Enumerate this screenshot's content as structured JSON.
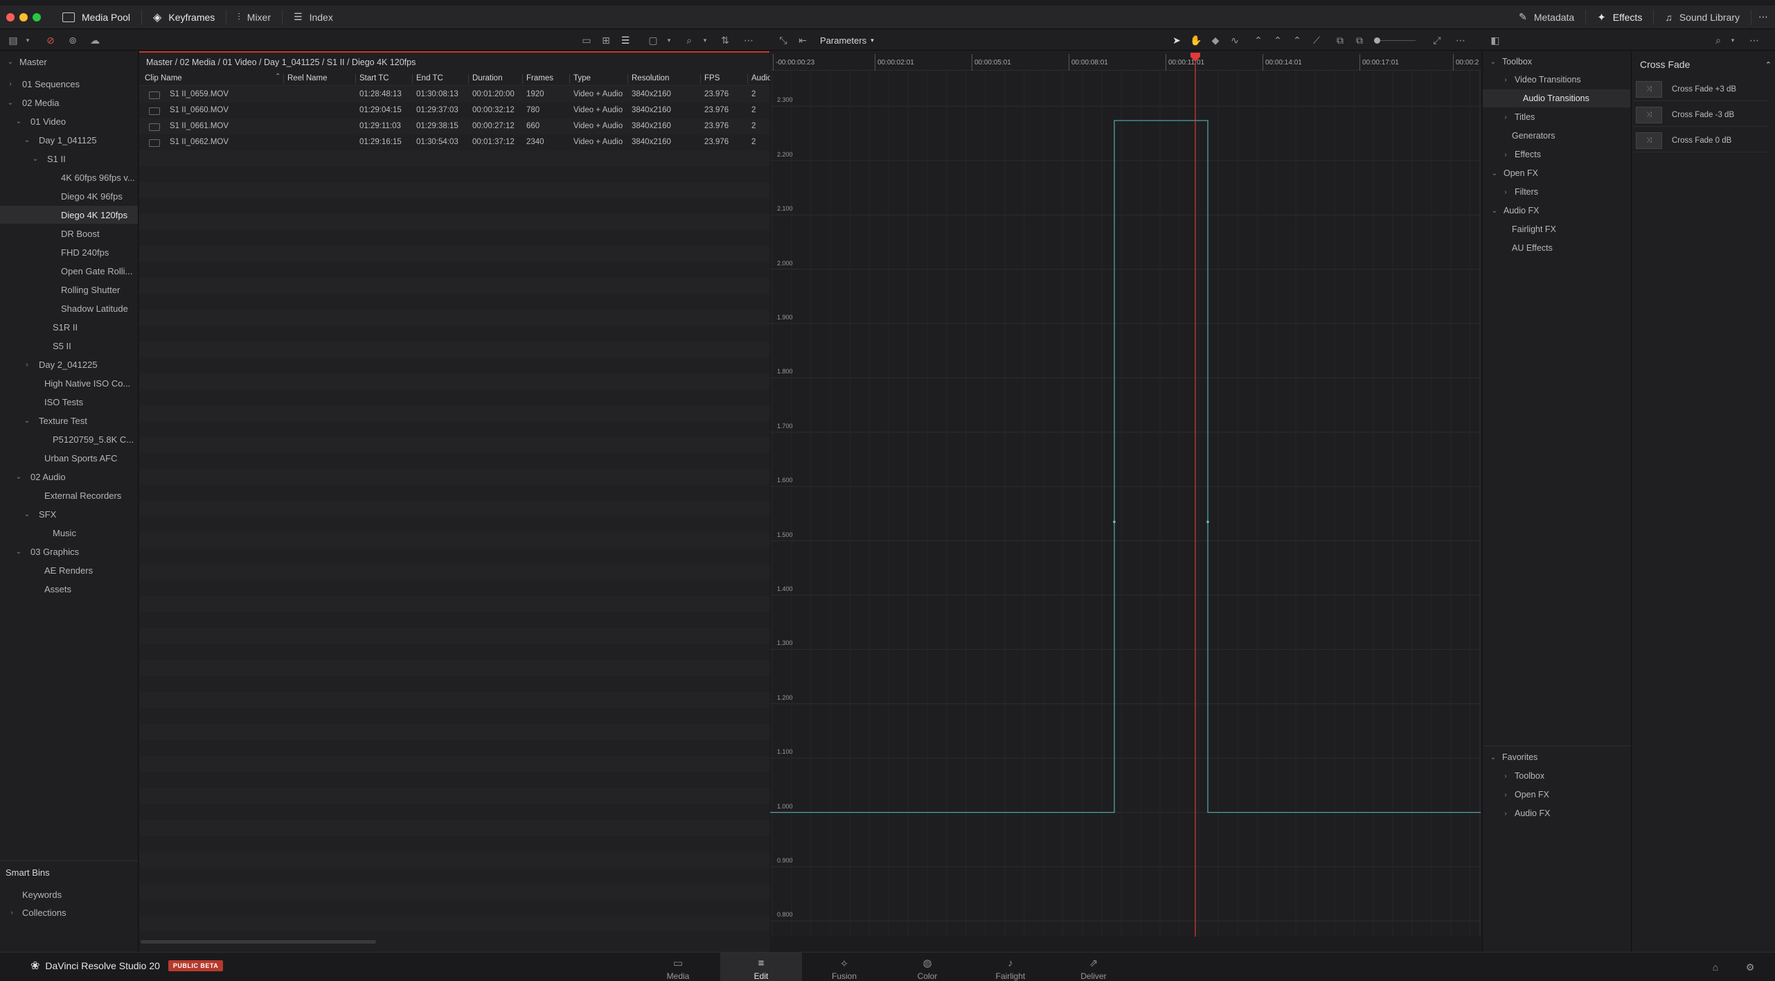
{
  "topbar": {
    "media_pool": "Media Pool",
    "keyframes": "Keyframes",
    "mixer": "Mixer",
    "index": "Index",
    "metadata": "Metadata",
    "effects": "Effects",
    "sound_library": "Sound Library"
  },
  "curve_editor": {
    "mode_label": "Parameters",
    "timecodes": [
      "-00:00:00:23",
      "00:00:02:01",
      "00:00:05:01",
      "00:00:08:01",
      "00:00:11:01",
      "00:00:14:01",
      "00:00:17:01",
      "00:00:2"
    ],
    "y_labels": [
      "2.300",
      "2.200",
      "2.100",
      "2.000",
      "1.900",
      "1.800",
      "1.700",
      "1.600",
      "1.500",
      "1.400",
      "1.300",
      "1.200",
      "1.100",
      "1.000",
      "0.900",
      "0.800"
    ]
  },
  "sidebar": {
    "master": "Master",
    "items": [
      {
        "label": "01 Sequences"
      },
      {
        "label": "02 Media"
      },
      {
        "label": "01 Video"
      },
      {
        "label": "Day 1_041125"
      },
      {
        "label": "S1 II"
      },
      {
        "label": "4K 60fps 96fps v..."
      },
      {
        "label": "Diego 4K 96fps"
      },
      {
        "label": "Diego 4K 120fps"
      },
      {
        "label": "DR Boost"
      },
      {
        "label": "FHD 240fps"
      },
      {
        "label": "Open Gate Rolli..."
      },
      {
        "label": "Rolling Shutter"
      },
      {
        "label": "Shadow Latitude"
      },
      {
        "label": "S1R II"
      },
      {
        "label": "S5 II"
      },
      {
        "label": "Day 2_041225"
      },
      {
        "label": "High Native ISO Co..."
      },
      {
        "label": "ISO Tests"
      },
      {
        "label": "Texture Test"
      },
      {
        "label": "P5120759_5.8K C..."
      },
      {
        "label": "Urban Sports AFC"
      },
      {
        "label": "02 Audio"
      },
      {
        "label": "External Recorders"
      },
      {
        "label": "SFX"
      },
      {
        "label": "Music"
      },
      {
        "label": "03 Graphics"
      },
      {
        "label": "AE Renders"
      },
      {
        "label": "Assets"
      }
    ],
    "smart_bins": "Smart Bins",
    "keywords": "Keywords",
    "collections": "Collections"
  },
  "clips": {
    "breadcrumb": "Master / 02 Media / 01 Video / Day 1_041125 / S1 II / Diego 4K 120fps",
    "headers": [
      "Clip Name",
      "Reel Name",
      "Start TC",
      "End TC",
      "Duration",
      "Frames",
      "Type",
      "Resolution",
      "FPS",
      "Audio"
    ],
    "rows": [
      {
        "name": "S1 II_0659.MOV",
        "start": "01:28:48:13",
        "end": "01:30:08:13",
        "duration": "00:01:20:00",
        "frames": "1920",
        "type": "Video + Audio",
        "res": "3840x2160",
        "fps": "23.976",
        "audio": "2"
      },
      {
        "name": "S1 II_0660.MOV",
        "start": "01:29:04:15",
        "end": "01:29:37:03",
        "duration": "00:00:32:12",
        "frames": "780",
        "type": "Video + Audio",
        "res": "3840x2160",
        "fps": "23.976",
        "audio": "2"
      },
      {
        "name": "S1 II_0661.MOV",
        "start": "01:29:11:03",
        "end": "01:29:38:15",
        "duration": "00:00:27:12",
        "frames": "660",
        "type": "Video + Audio",
        "res": "3840x2160",
        "fps": "23.976",
        "audio": "2"
      },
      {
        "name": "S1 II_0662.MOV",
        "start": "01:29:16:15",
        "end": "01:30:54:03",
        "duration": "00:01:37:12",
        "frames": "2340",
        "type": "Video + Audio",
        "res": "3840x2160",
        "fps": "23.976",
        "audio": "2"
      }
    ]
  },
  "toolbox": {
    "root": "Toolbox",
    "items": [
      "Video Transitions",
      "Audio Transitions",
      "Titles",
      "Generators",
      "Effects",
      "Open FX",
      "Filters",
      "Audio FX",
      "Fairlight FX",
      "AU Effects"
    ],
    "favorites": "Favorites",
    "fav_items": [
      "Toolbox",
      "Open FX",
      "Audio FX"
    ]
  },
  "crossfade": {
    "title": "Cross Fade",
    "items": [
      "Cross Fade +3 dB",
      "Cross Fade -3 dB",
      "Cross Fade 0 dB"
    ]
  },
  "bottombar": {
    "app_name": "DaVinci Resolve Studio 20",
    "badge": "PUBLIC BETA",
    "pages": [
      "Media",
      "Edit",
      "Fusion",
      "Color",
      "Fairlight",
      "Deliver"
    ]
  }
}
